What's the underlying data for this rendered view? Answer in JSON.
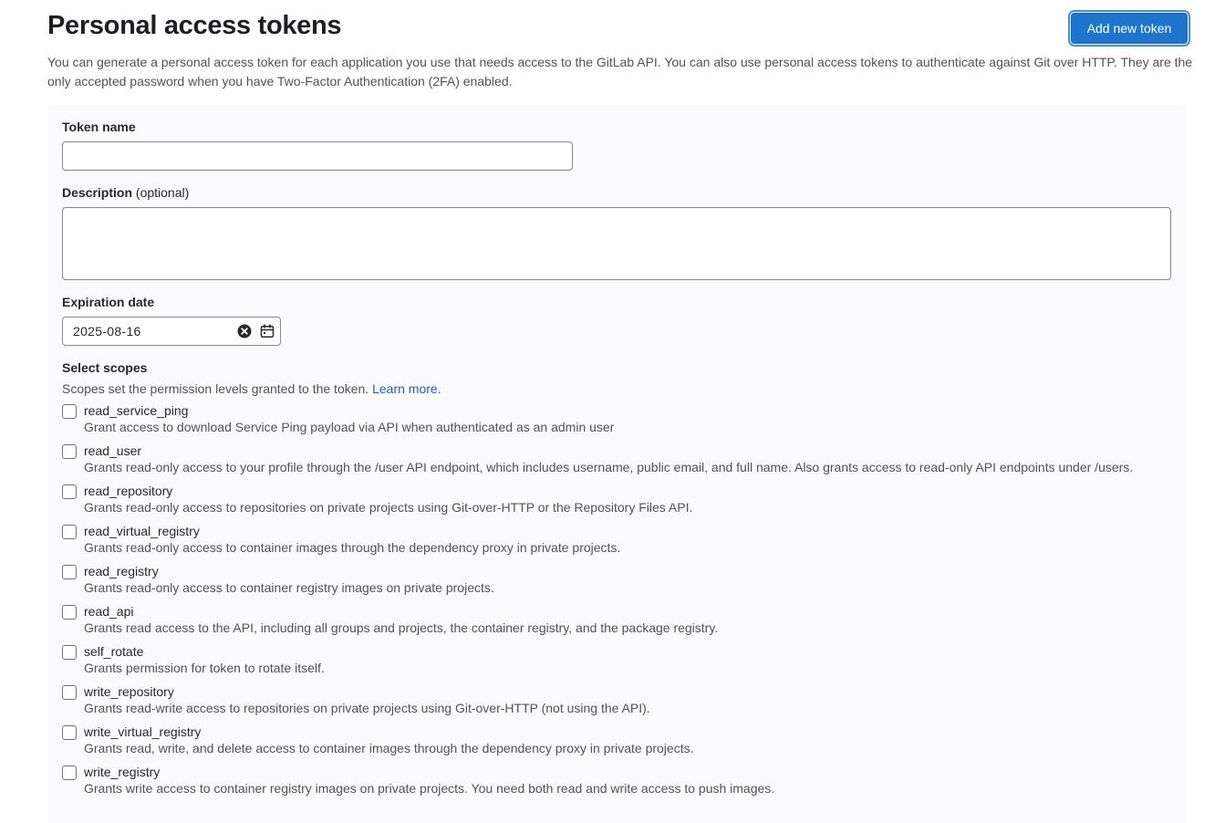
{
  "header": {
    "title": "Personal access tokens",
    "add_button_label": "Add new token"
  },
  "intro_text": "You can generate a personal access token for each application you use that needs access to the GitLab API. You can also use personal access tokens to authenticate against Git over HTTP. They are the only accepted password when you have Two-Factor Authentication (2FA) enabled.",
  "form": {
    "token_name_label": "Token name",
    "token_name_value": "",
    "description_label": "Description",
    "description_optional": "(optional)",
    "description_value": "",
    "expiration_label": "Expiration date",
    "expiration_value": "2025-08-16",
    "scopes_label": "Select scopes",
    "scopes_help": "Scopes set the permission levels granted to the token.",
    "scopes_learn_more": "Learn more",
    "scopes": [
      {
        "name": "read_service_ping",
        "description": "Grant access to download Service Ping payload via API when authenticated as an admin user",
        "checked": false
      },
      {
        "name": "read_user",
        "description": "Grants read-only access to your profile through the /user API endpoint, which includes username, public email, and full name. Also grants access to read-only API endpoints under /users.",
        "checked": false
      },
      {
        "name": "read_repository",
        "description": "Grants read-only access to repositories on private projects using Git-over-HTTP or the Repository Files API.",
        "checked": false
      },
      {
        "name": "read_virtual_registry",
        "description": "Grants read-only access to container images through the dependency proxy in private projects.",
        "checked": false
      },
      {
        "name": "read_registry",
        "description": "Grants read-only access to container registry images on private projects.",
        "checked": false
      },
      {
        "name": "read_api",
        "description": "Grants read access to the API, including all groups and projects, the container registry, and the package registry.",
        "checked": false
      },
      {
        "name": "self_rotate",
        "description": "Grants permission for token to rotate itself.",
        "checked": false
      },
      {
        "name": "write_repository",
        "description": "Grants read-write access to repositories on private projects using Git-over-HTTP (not using the API).",
        "checked": false
      },
      {
        "name": "write_virtual_registry",
        "description": "Grants read, write, and delete access to container images through the dependency proxy in private projects.",
        "checked": false
      },
      {
        "name": "write_registry",
        "description": "Grants write access to container registry images on private projects. You need both read and write access to push images.",
        "checked": false
      }
    ]
  },
  "colors": {
    "primary_button": "#1f75cb",
    "link": "#1f62b5",
    "panel_background": "#fbfafd"
  }
}
